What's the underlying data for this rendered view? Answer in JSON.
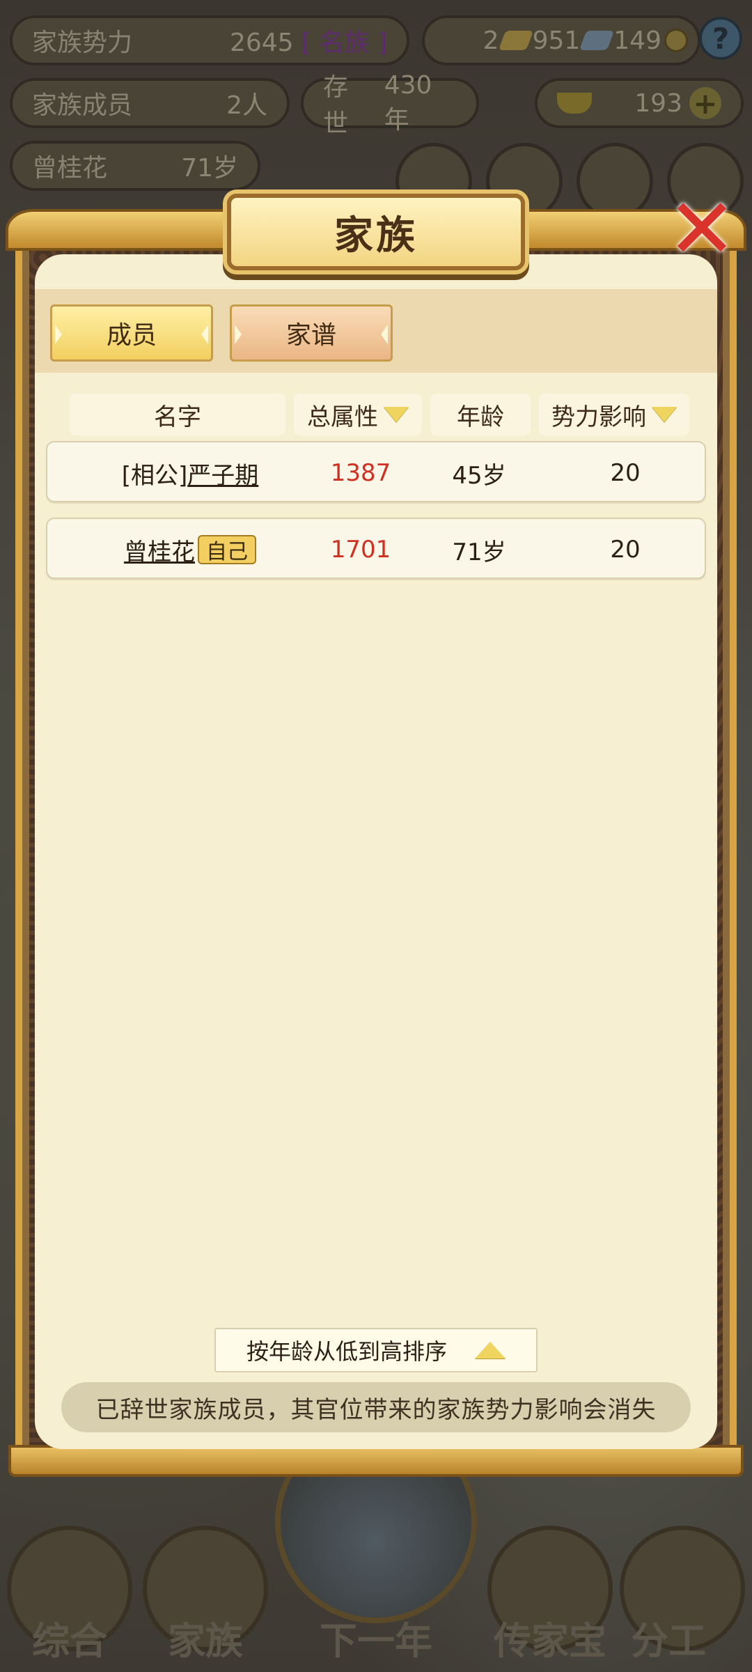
{
  "hud": {
    "family_power_label": "家族势力",
    "family_power_value": "2645",
    "family_power_rank": "[ 名族 ]",
    "gold": "2",
    "silver": "951",
    "copper": "149",
    "members_label": "家族成员",
    "members_value": "2人",
    "existence_label": "存世",
    "existence_value": "430年",
    "ingots": "193",
    "current_member_name": "曾桂花",
    "current_member_age": "71岁"
  },
  "bottom_nav": {
    "general": "综合",
    "family": "家族",
    "next_year": "下一年",
    "heirloom": "传家宝",
    "division": "分工"
  },
  "modal": {
    "title": "家族",
    "tabs": [
      {
        "label": "成员"
      },
      {
        "label": "家谱"
      }
    ],
    "columns": [
      "名字",
      "总属性",
      "年龄",
      "势力影响"
    ],
    "rows": [
      {
        "prefix": "[相公]",
        "name": "严子期",
        "badge": "",
        "total": "1387",
        "age": "45岁",
        "influence": "20"
      },
      {
        "prefix": "",
        "name": "曾桂花",
        "badge": "自己",
        "total": "1701",
        "age": "71岁",
        "influence": "20"
      }
    ],
    "sort_label": "按年龄从低到高排序",
    "notice": "已辞世家族成员，其官位带来的家族势力影响会消失"
  }
}
